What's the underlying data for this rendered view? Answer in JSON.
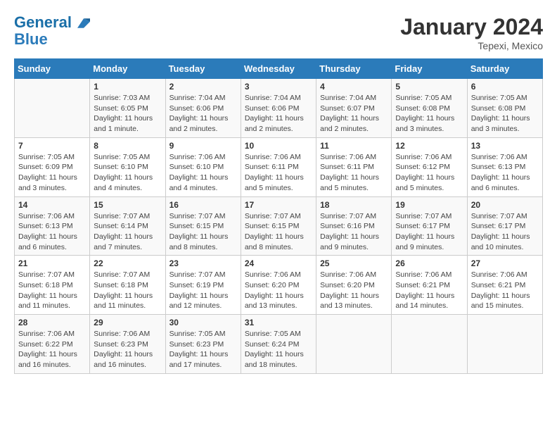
{
  "header": {
    "logo_line1": "General",
    "logo_line2": "Blue",
    "month": "January 2024",
    "location": "Tepexi, Mexico"
  },
  "days_of_week": [
    "Sunday",
    "Monday",
    "Tuesday",
    "Wednesday",
    "Thursday",
    "Friday",
    "Saturday"
  ],
  "weeks": [
    [
      {
        "day": "",
        "sunrise": "",
        "sunset": "",
        "daylight": ""
      },
      {
        "day": "1",
        "sunrise": "Sunrise: 7:03 AM",
        "sunset": "Sunset: 6:05 PM",
        "daylight": "Daylight: 11 hours and 1 minute."
      },
      {
        "day": "2",
        "sunrise": "Sunrise: 7:04 AM",
        "sunset": "Sunset: 6:06 PM",
        "daylight": "Daylight: 11 hours and 2 minutes."
      },
      {
        "day": "3",
        "sunrise": "Sunrise: 7:04 AM",
        "sunset": "Sunset: 6:06 PM",
        "daylight": "Daylight: 11 hours and 2 minutes."
      },
      {
        "day": "4",
        "sunrise": "Sunrise: 7:04 AM",
        "sunset": "Sunset: 6:07 PM",
        "daylight": "Daylight: 11 hours and 2 minutes."
      },
      {
        "day": "5",
        "sunrise": "Sunrise: 7:05 AM",
        "sunset": "Sunset: 6:08 PM",
        "daylight": "Daylight: 11 hours and 3 minutes."
      },
      {
        "day": "6",
        "sunrise": "Sunrise: 7:05 AM",
        "sunset": "Sunset: 6:08 PM",
        "daylight": "Daylight: 11 hours and 3 minutes."
      }
    ],
    [
      {
        "day": "7",
        "sunrise": "Sunrise: 7:05 AM",
        "sunset": "Sunset: 6:09 PM",
        "daylight": "Daylight: 11 hours and 3 minutes."
      },
      {
        "day": "8",
        "sunrise": "Sunrise: 7:05 AM",
        "sunset": "Sunset: 6:10 PM",
        "daylight": "Daylight: 11 hours and 4 minutes."
      },
      {
        "day": "9",
        "sunrise": "Sunrise: 7:06 AM",
        "sunset": "Sunset: 6:10 PM",
        "daylight": "Daylight: 11 hours and 4 minutes."
      },
      {
        "day": "10",
        "sunrise": "Sunrise: 7:06 AM",
        "sunset": "Sunset: 6:11 PM",
        "daylight": "Daylight: 11 hours and 5 minutes."
      },
      {
        "day": "11",
        "sunrise": "Sunrise: 7:06 AM",
        "sunset": "Sunset: 6:11 PM",
        "daylight": "Daylight: 11 hours and 5 minutes."
      },
      {
        "day": "12",
        "sunrise": "Sunrise: 7:06 AM",
        "sunset": "Sunset: 6:12 PM",
        "daylight": "Daylight: 11 hours and 5 minutes."
      },
      {
        "day": "13",
        "sunrise": "Sunrise: 7:06 AM",
        "sunset": "Sunset: 6:13 PM",
        "daylight": "Daylight: 11 hours and 6 minutes."
      }
    ],
    [
      {
        "day": "14",
        "sunrise": "Sunrise: 7:06 AM",
        "sunset": "Sunset: 6:13 PM",
        "daylight": "Daylight: 11 hours and 6 minutes."
      },
      {
        "day": "15",
        "sunrise": "Sunrise: 7:07 AM",
        "sunset": "Sunset: 6:14 PM",
        "daylight": "Daylight: 11 hours and 7 minutes."
      },
      {
        "day": "16",
        "sunrise": "Sunrise: 7:07 AM",
        "sunset": "Sunset: 6:15 PM",
        "daylight": "Daylight: 11 hours and 8 minutes."
      },
      {
        "day": "17",
        "sunrise": "Sunrise: 7:07 AM",
        "sunset": "Sunset: 6:15 PM",
        "daylight": "Daylight: 11 hours and 8 minutes."
      },
      {
        "day": "18",
        "sunrise": "Sunrise: 7:07 AM",
        "sunset": "Sunset: 6:16 PM",
        "daylight": "Daylight: 11 hours and 9 minutes."
      },
      {
        "day": "19",
        "sunrise": "Sunrise: 7:07 AM",
        "sunset": "Sunset: 6:17 PM",
        "daylight": "Daylight: 11 hours and 9 minutes."
      },
      {
        "day": "20",
        "sunrise": "Sunrise: 7:07 AM",
        "sunset": "Sunset: 6:17 PM",
        "daylight": "Daylight: 11 hours and 10 minutes."
      }
    ],
    [
      {
        "day": "21",
        "sunrise": "Sunrise: 7:07 AM",
        "sunset": "Sunset: 6:18 PM",
        "daylight": "Daylight: 11 hours and 11 minutes."
      },
      {
        "day": "22",
        "sunrise": "Sunrise: 7:07 AM",
        "sunset": "Sunset: 6:18 PM",
        "daylight": "Daylight: 11 hours and 11 minutes."
      },
      {
        "day": "23",
        "sunrise": "Sunrise: 7:07 AM",
        "sunset": "Sunset: 6:19 PM",
        "daylight": "Daylight: 11 hours and 12 minutes."
      },
      {
        "day": "24",
        "sunrise": "Sunrise: 7:06 AM",
        "sunset": "Sunset: 6:20 PM",
        "daylight": "Daylight: 11 hours and 13 minutes."
      },
      {
        "day": "25",
        "sunrise": "Sunrise: 7:06 AM",
        "sunset": "Sunset: 6:20 PM",
        "daylight": "Daylight: 11 hours and 13 minutes."
      },
      {
        "day": "26",
        "sunrise": "Sunrise: 7:06 AM",
        "sunset": "Sunset: 6:21 PM",
        "daylight": "Daylight: 11 hours and 14 minutes."
      },
      {
        "day": "27",
        "sunrise": "Sunrise: 7:06 AM",
        "sunset": "Sunset: 6:21 PM",
        "daylight": "Daylight: 11 hours and 15 minutes."
      }
    ],
    [
      {
        "day": "28",
        "sunrise": "Sunrise: 7:06 AM",
        "sunset": "Sunset: 6:22 PM",
        "daylight": "Daylight: 11 hours and 16 minutes."
      },
      {
        "day": "29",
        "sunrise": "Sunrise: 7:06 AM",
        "sunset": "Sunset: 6:23 PM",
        "daylight": "Daylight: 11 hours and 16 minutes."
      },
      {
        "day": "30",
        "sunrise": "Sunrise: 7:05 AM",
        "sunset": "Sunset: 6:23 PM",
        "daylight": "Daylight: 11 hours and 17 minutes."
      },
      {
        "day": "31",
        "sunrise": "Sunrise: 7:05 AM",
        "sunset": "Sunset: 6:24 PM",
        "daylight": "Daylight: 11 hours and 18 minutes."
      },
      {
        "day": "",
        "sunrise": "",
        "sunset": "",
        "daylight": ""
      },
      {
        "day": "",
        "sunrise": "",
        "sunset": "",
        "daylight": ""
      },
      {
        "day": "",
        "sunrise": "",
        "sunset": "",
        "daylight": ""
      }
    ]
  ]
}
